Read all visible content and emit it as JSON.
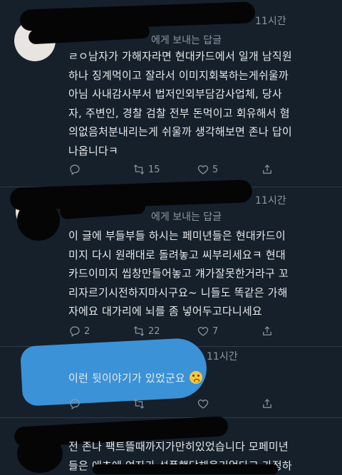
{
  "tweets": [
    {
      "time": "11시간",
      "replying": "에게 보내는 답글",
      "text_lines": [
        "ㄹㅇ남자가 가해자라면 현대카드에서 일개 남직원",
        "하나 징계먹이고 잘라서 이미지회복하는게쉬울까",
        "아님 사내감사부서 법저인외부담감사업체, 당사",
        "자, 주변인, 경찰 검찰 전부 돈먹이고 회유해서 혐",
        "의없음처분내리는게 쉬울까 생각해보면 존나 답이",
        "나옵니다ㅋ"
      ],
      "reply_count": "",
      "retweet_count": "15",
      "like_count": "5"
    },
    {
      "time": "11시간",
      "replying": "에게 보내는 답글",
      "text_lines": [
        "이 글에 부들부들 하시는 페미년들은 현대카드이",
        "미지 다시 원래대로 돌려놓고 씨부리세요ㅋ 현대",
        "카드이미지 씹창만들어놓고 걔가잘못한거라구 꼬",
        "리자르기시전하지마시구요~ 니들도 똑같은 가해",
        "자에요 대가리에 뇌를 좀 넣어두고다니세요"
      ],
      "reply_count": "2",
      "retweet_count": "22",
      "like_count": "7"
    },
    {
      "time": "11시간",
      "text_lines": [
        "이런 뒷이야기가 있었군요"
      ],
      "reply_count": "",
      "retweet_count": "",
      "like_count": ""
    },
    {
      "time": "",
      "text_lines": [
        "전 존나 팩트뜰때까지가만히있었습니다 모페미년",
        "들은 애초에 여자가 성폭행당해을리없다고 가정하"
      ]
    }
  ],
  "icons": {
    "reply": "reply-icon",
    "retweet": "retweet-icon",
    "like": "heart-icon",
    "share": "share-icon",
    "emoji": "worried-face-emoji"
  }
}
